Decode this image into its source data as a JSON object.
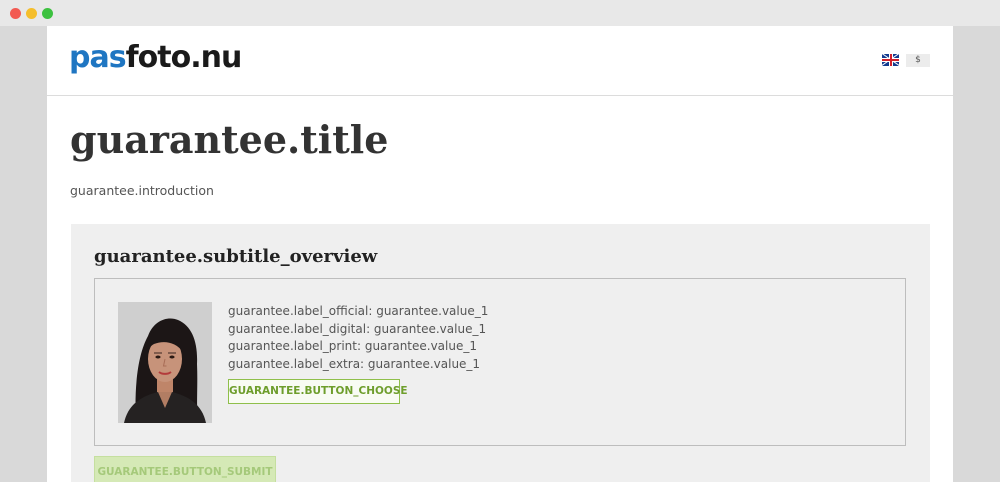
{
  "brand": {
    "logo_accent": "pas",
    "logo_rest": "foto.nu",
    "accent_color": "#1f76c2"
  },
  "header": {
    "language_icon": "uk-flag-icon",
    "currency_label": "$"
  },
  "main": {
    "title": "guarantee.title",
    "introduction": "guarantee.introduction"
  },
  "overview": {
    "subtitle": "guarantee.subtitle_overview",
    "photo_icon": "passport-photo",
    "lines": [
      "guarantee.label_official: guarantee.value_1",
      "guarantee.label_digital: guarantee.value_1",
      "guarantee.label_print: guarantee.value_1",
      "guarantee.label_extra: guarantee.value_1"
    ],
    "choose_button": "GUARANTEE.BUTTON_CHOOSE",
    "submit_button": "GUARANTEE.BUTTON_SUBMIT",
    "button_color": "#8fbf4a"
  }
}
